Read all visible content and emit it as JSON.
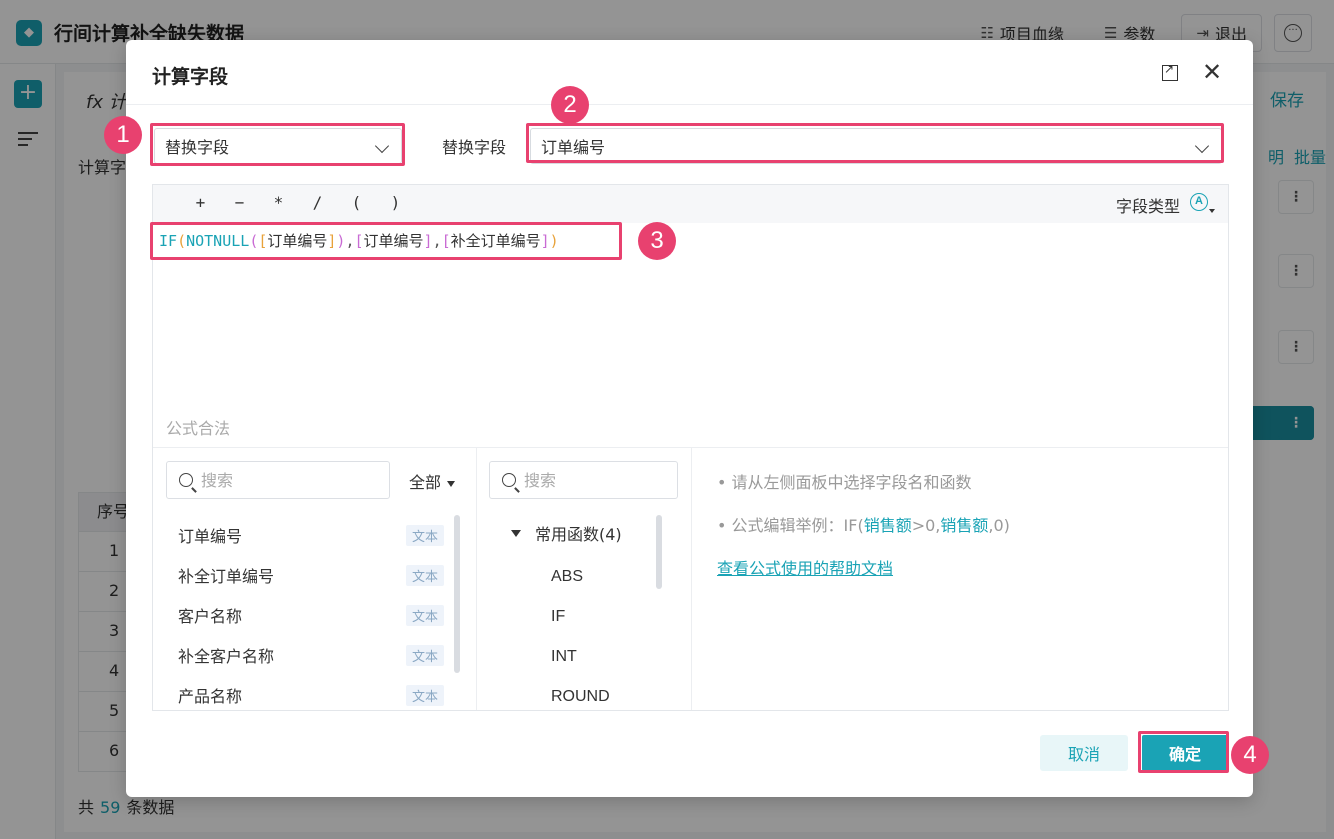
{
  "app": {
    "title": "行间计算补全缺失数据",
    "actions": {
      "lineage": "项目血缘",
      "params": "参数",
      "exit": "退出"
    }
  },
  "background": {
    "fx_label": "fx 计",
    "save": "保存",
    "calc_field_label": "计算字",
    "right_links": [
      "明",
      "批量"
    ],
    "grid_header": "序号",
    "row_numbers": [
      "1",
      "2",
      "3",
      "4",
      "5",
      "6"
    ],
    "footer": {
      "prefix": "共",
      "count": "59",
      "suffix": "条数据"
    }
  },
  "dialog": {
    "title": "计算字段",
    "mode_select": "替换字段",
    "target_label": "替换字段",
    "target_select": "订单编号",
    "operators": [
      "+",
      "−",
      "*",
      "/",
      "(",
      ")"
    ],
    "field_type_label": "字段类型",
    "field_type_icon": "A",
    "formula": {
      "fn_if": "IF",
      "fn_notnull": "NOTNULL",
      "field_1": "订单编号",
      "field_2": "订单编号",
      "field_3": "补全订单编号"
    },
    "validity": "公式合法",
    "field_search_placeholder": "搜索",
    "filter": "全部",
    "fields": [
      {
        "name": "订单编号",
        "type": "文本"
      },
      {
        "name": "补全订单编号",
        "type": "文本"
      },
      {
        "name": "客户名称",
        "type": "文本"
      },
      {
        "name": "补全客户名称",
        "type": "文本"
      },
      {
        "name": "产品名称",
        "type": "文本"
      }
    ],
    "function_search_placeholder": "搜索",
    "function_group": "常用函数(4)",
    "functions": [
      "ABS",
      "IF",
      "INT",
      "ROUND"
    ],
    "hints": {
      "line1": "• 请从左侧面板中选择字段名和函数",
      "line2_prefix": "• 公式编辑举例：IF(",
      "line2_field1": "销售额",
      "line2_mid": ">0,",
      "line2_field2": "销售额",
      "line2_suffix": ",0)",
      "help_link": "查看公式使用的帮助文档"
    },
    "cancel": "取消",
    "confirm": "确定"
  },
  "annotations": [
    "1",
    "2",
    "3",
    "4"
  ],
  "colors": {
    "accent": "#1aa3b5",
    "highlight": "#e8416f"
  }
}
